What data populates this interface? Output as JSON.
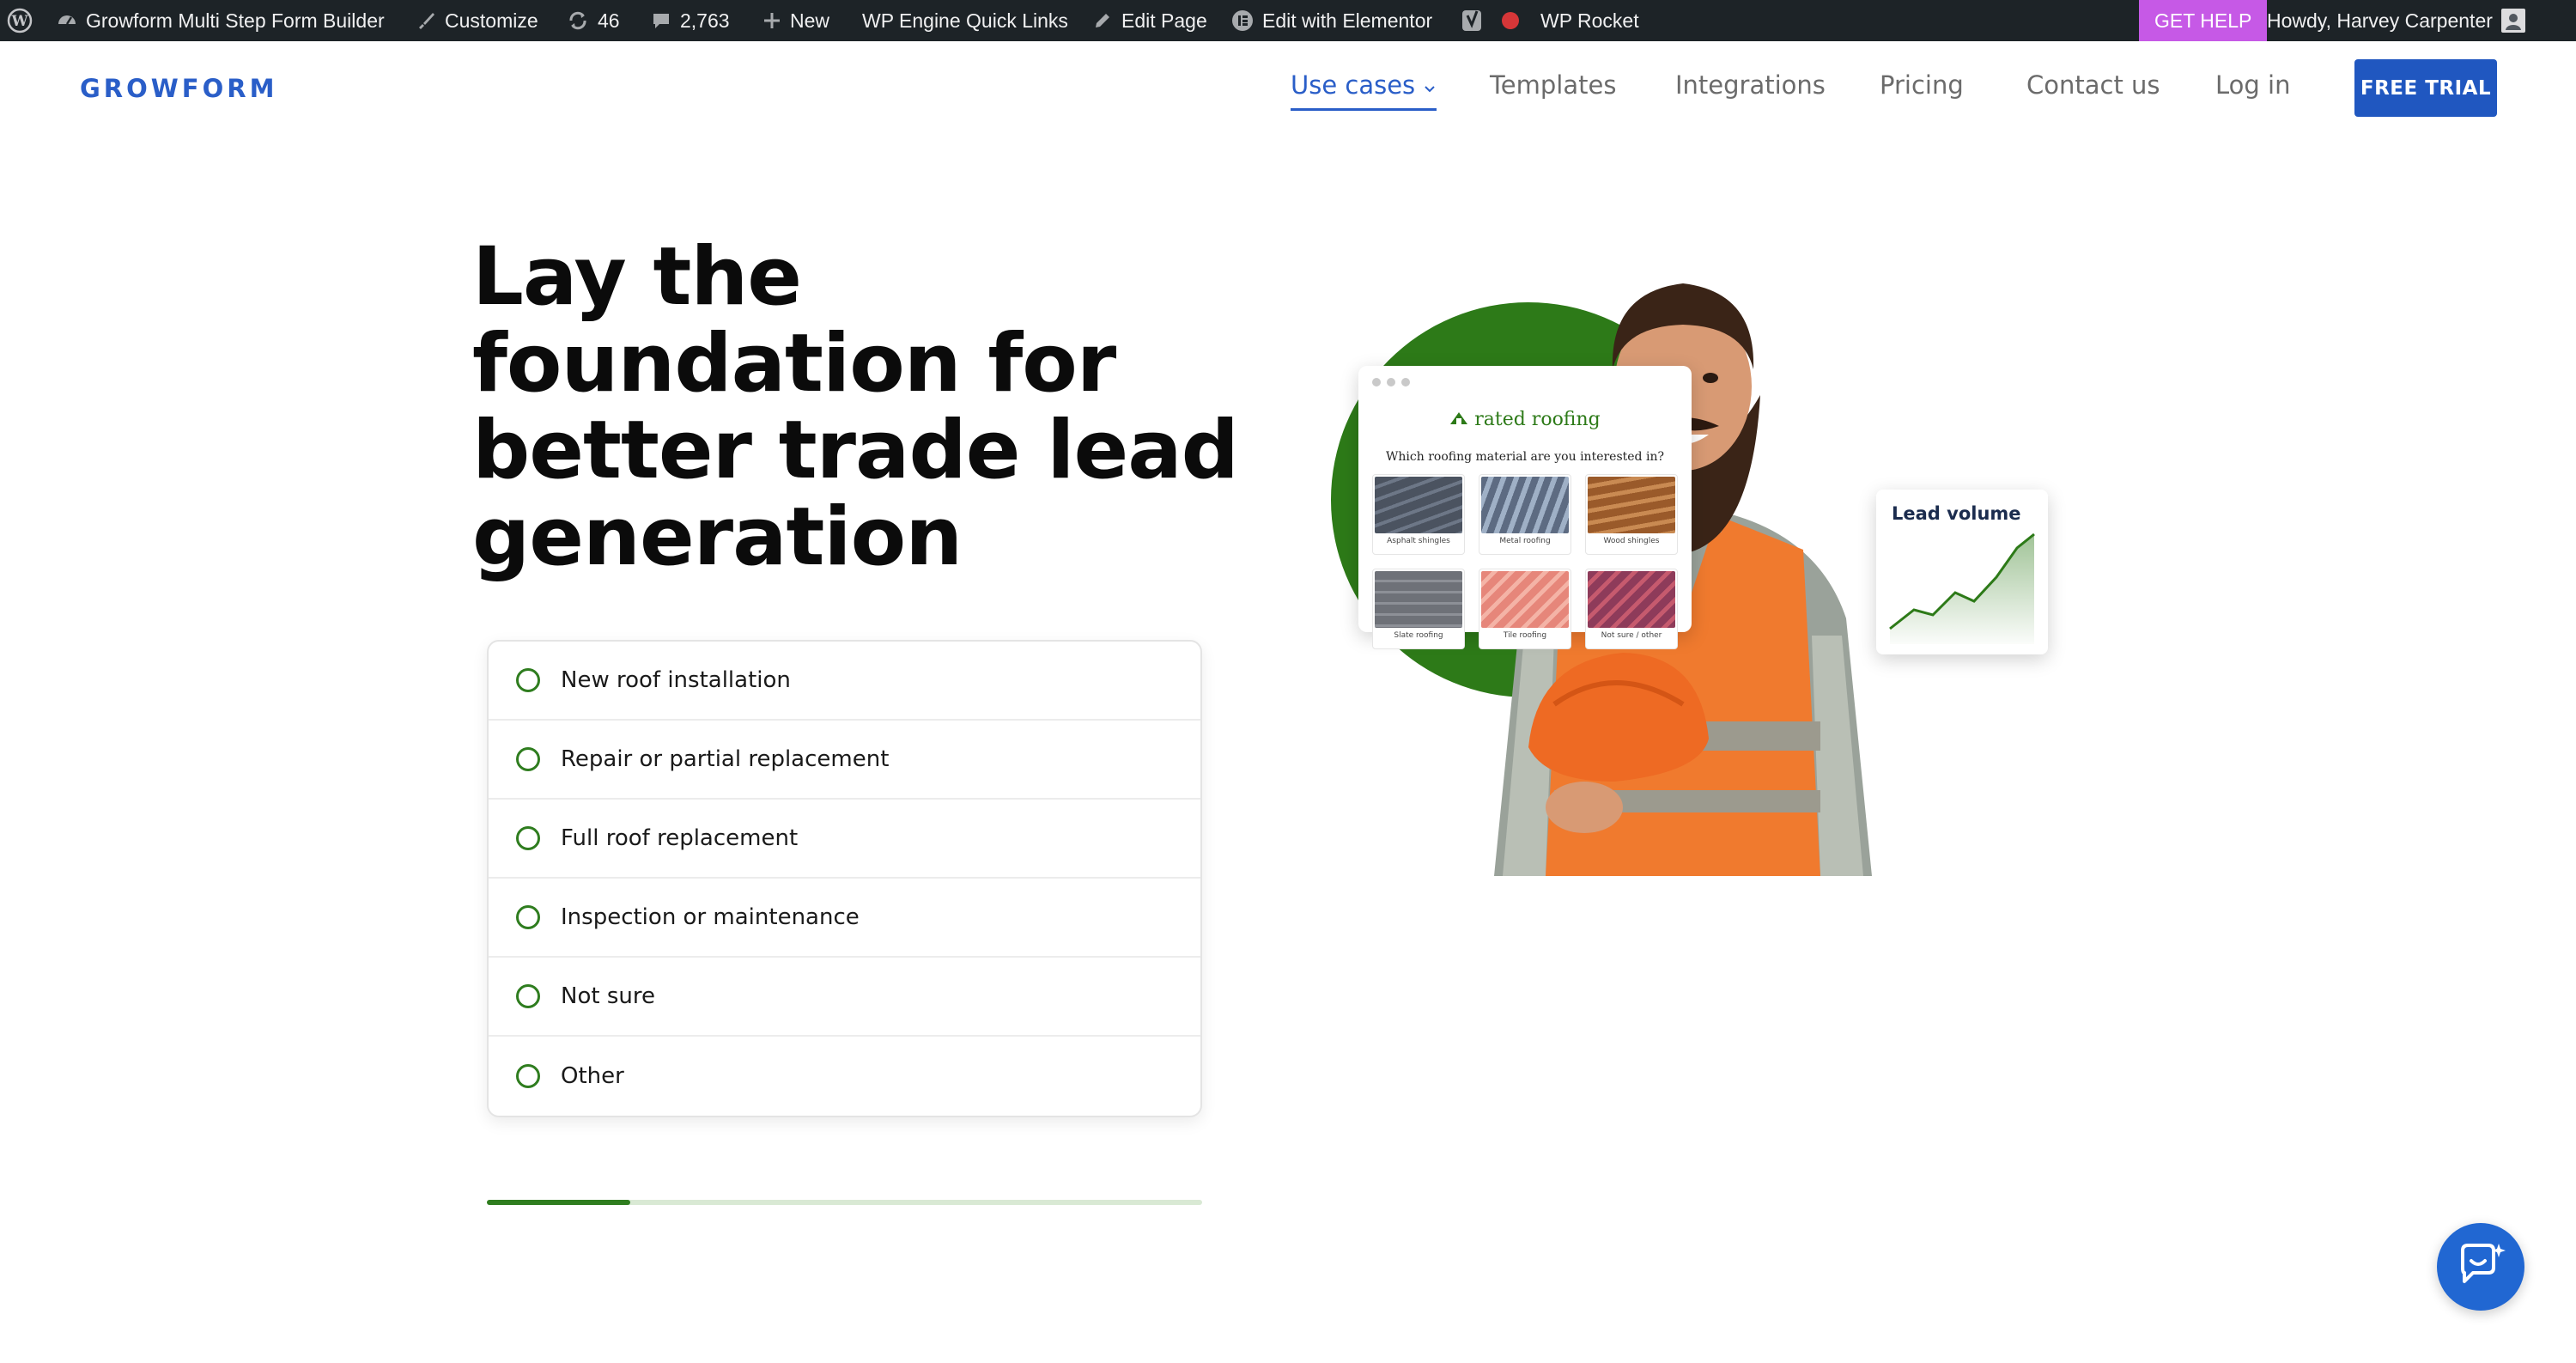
{
  "admin_bar": {
    "site_name": "Growform Multi Step Form Builder",
    "customize": "Customize",
    "updates_count": "46",
    "comments_count": "2,763",
    "new": "New",
    "quick_links": "WP Engine Quick Links",
    "edit_page": "Edit Page",
    "edit_elementor": "Edit with Elementor",
    "wp_rocket": "WP Rocket",
    "get_help": "GET HELP",
    "howdy": "Howdy, Harvey Carpenter"
  },
  "header": {
    "brand": "GROWFORM",
    "nav": {
      "use_cases": "Use cases",
      "templates": "Templates",
      "integrations": "Integrations",
      "pricing": "Pricing",
      "contact": "Contact us",
      "login": "Log in"
    },
    "cta": "FREE TRIAL"
  },
  "hero": {
    "headline_lines": [
      "Lay the",
      "foundation for",
      "better trade lead",
      "generation"
    ],
    "options": [
      "New roof installation",
      "Repair or partial replacement",
      "Full roof replacement",
      "Inspection or maintenance",
      "Not sure",
      "Other"
    ],
    "progress_fraction": 0.2
  },
  "illustration": {
    "form_card": {
      "brand": "rated roofing",
      "question": "Which roofing material are you interested in?",
      "tiles": [
        "Asphalt shingles",
        "Metal roofing",
        "Wood shingles",
        "Slate roofing",
        "Tile roofing",
        "Not sure / other"
      ]
    },
    "lead_card": {
      "title": "Lead volume"
    }
  },
  "colors": {
    "brand_blue": "#2a5ec8",
    "cta_blue": "#2057c0",
    "accent_green": "#2d7a18",
    "get_help_purple": "#c659e6",
    "admin_bar_bg": "#1d2327"
  },
  "icons": [
    "wordpress-icon",
    "dashboard-icon",
    "brush-icon",
    "refresh-icon",
    "comment-icon",
    "plus-icon",
    "pencil-icon",
    "elementor-icon",
    "yoast-icon",
    "rocket-status-dot",
    "chevron-down-icon",
    "chat-icon"
  ]
}
